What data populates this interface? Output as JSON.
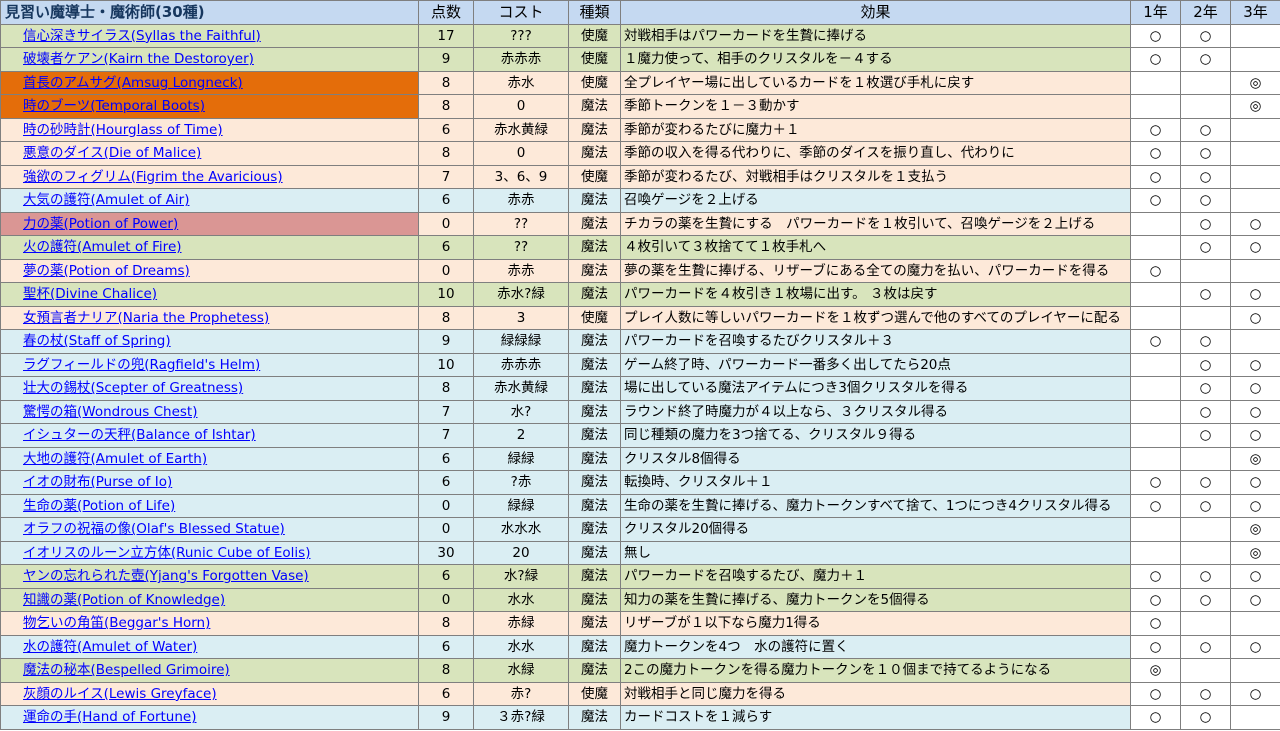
{
  "header": {
    "title": "見習い魔導士・魔術師(30種)",
    "points": "点数",
    "cost": "コスト",
    "kind": "種類",
    "effect": "効果",
    "y1": "1年",
    "y2": "2年",
    "y3": "3年"
  },
  "colors": {
    "green": "#d8e4bc",
    "blue": "#daeef3",
    "peach": "#fde9d9",
    "orange": "#e46d0a",
    "rose": "#da9694",
    "header": "#c5d9f1",
    "link": "#0000ff"
  },
  "rows": [
    {
      "name": "信心深きサイラス(Syllas the Faithful)",
      "bg": "green",
      "points": "17",
      "cost": "???",
      "kind": "使魔",
      "effect": "対戦相手はパワーカードを生贄に捧げる",
      "y1": "○",
      "y2": "○",
      "y3": ""
    },
    {
      "name": "破壊者ケアン(Kairn the Destoroyer)",
      "bg": "green",
      "points": "9",
      "cost": "赤赤赤",
      "kind": "使魔",
      "effect": "１魔力使って、相手のクリスタルを－４する",
      "y1": "○",
      "y2": "○",
      "y3": ""
    },
    {
      "name": "首長のアムサグ(Amsug Longneck)",
      "bg": "orange",
      "points": "8",
      "cost": "赤水",
      "kind": "使魔",
      "effect": "全プレイヤー場に出しているカードを１枚選び手札に戻す",
      "y1": "",
      "y2": "",
      "y3": "◎"
    },
    {
      "name": "時のブーツ(Temporal Boots)",
      "bg": "orange",
      "points": "8",
      "cost": "0",
      "kind": "魔法",
      "effect": "季節トークンを１－３動かす",
      "y1": "",
      "y2": "",
      "y3": "◎"
    },
    {
      "name": "時の砂時計(Hourglass of Time)",
      "bg": "peach",
      "points": "6",
      "cost": "赤水黄緑",
      "kind": "魔法",
      "effect": "季節が変わるたびに魔力＋１",
      "y1": "○",
      "y2": "○",
      "y3": ""
    },
    {
      "name": "悪意のダイス(Die of Malice)",
      "bg": "peach",
      "points": "8",
      "cost": "0",
      "kind": "魔法",
      "effect": "季節の収入を得る代わりに、季節のダイスを振り直し、代わりに",
      "y1": "○",
      "y2": "○",
      "y3": ""
    },
    {
      "name": "強欲のフィグリム(Figrim the Avaricious)",
      "bg": "peach",
      "points": "7",
      "cost": "3、6、9",
      "kind": "使魔",
      "effect": "季節が変わるたび、対戦相手はクリスタルを１支払う",
      "y1": "○",
      "y2": "○",
      "y3": ""
    },
    {
      "name": "大気の護符(Amulet of Air)",
      "bg": "blue",
      "points": "6",
      "cost": "赤赤",
      "kind": "魔法",
      "effect": "召喚ゲージを２上げる",
      "y1": "○",
      "y2": "○",
      "y3": ""
    },
    {
      "name": "力の薬(Potion of Power)",
      "bg": "rose",
      "points": "0",
      "cost": "??",
      "kind": "魔法",
      "effect": "チカラの薬を生贄にする　パワーカードを１枚引いて、召喚ゲージを２上げる",
      "y1": "",
      "y2": "○",
      "y3": "○"
    },
    {
      "name": "火の護符(Amulet of Fire)",
      "bg": "green",
      "points": "6",
      "cost": "??",
      "kind": "魔法",
      "effect": "４枚引いて３枚捨てて１枚手札へ",
      "y1": "",
      "y2": "○",
      "y3": "○"
    },
    {
      "name": "夢の薬(Potion of Dreams)",
      "bg": "peach",
      "points": "0",
      "cost": "赤赤",
      "kind": "魔法",
      "effect": "夢の薬を生贄に捧げる、リザーブにある全ての魔力を払い、パワーカードを得る",
      "y1": "○",
      "y2": "",
      "y3": ""
    },
    {
      "name": "聖杯(Divine Chalice)",
      "bg": "green",
      "points": "10",
      "cost": "赤水?緑",
      "kind": "魔法",
      "effect": "パワーカードを４枚引き１枚場に出す。 ３枚は戻す",
      "y1": "",
      "y2": "○",
      "y3": "○"
    },
    {
      "name": "女預言者ナリア(Naria the Prophetess)",
      "bg": "peach",
      "points": "8",
      "cost": "3",
      "kind": "使魔",
      "effect": "プレイ人数に等しいパワーカードを１枚ずつ選んで他のすべてのプレイヤーに配る",
      "y1": "",
      "y2": "",
      "y3": "○"
    },
    {
      "name": "春の杖(Staff of Spring)",
      "bg": "blue",
      "points": "9",
      "cost": "緑緑緑",
      "kind": "魔法",
      "effect": "パワーカードを召喚するたびクリスタル＋３",
      "y1": "○",
      "y2": "○",
      "y3": ""
    },
    {
      "name": "ラグフィールドの兜(Ragfield's Helm)",
      "bg": "blue",
      "points": "10",
      "cost": "赤赤赤",
      "kind": "魔法",
      "effect": "ゲーム終了時、パワーカード一番多く出してたら20点",
      "y1": "",
      "y2": "○",
      "y3": "○"
    },
    {
      "name": "壮大の錫杖(Scepter of Greatness)",
      "bg": "blue",
      "points": "8",
      "cost": "赤水黄緑",
      "kind": "魔法",
      "effect": "場に出している魔法アイテムにつき3個クリスタルを得る",
      "y1": "",
      "y2": "○",
      "y3": "○"
    },
    {
      "name": "驚愕の箱(Wondrous Chest)",
      "bg": "blue",
      "points": "7",
      "cost": "水?",
      "kind": "魔法",
      "effect": "ラウンド終了時魔力が４以上なら、３クリスタル得る",
      "y1": "",
      "y2": "○",
      "y3": "○"
    },
    {
      "name": "イシュターの天秤(Balance of Ishtar)",
      "bg": "blue",
      "points": "7",
      "cost": "2",
      "kind": "魔法",
      "effect": "同じ種類の魔力を3つ捨てる、クリスタル９得る",
      "y1": "",
      "y2": "○",
      "y3": "○"
    },
    {
      "name": "大地の護符(Amulet of Earth)",
      "bg": "blue",
      "points": "6",
      "cost": "緑緑",
      "kind": "魔法",
      "effect": "クリスタル8個得る",
      "y1": "",
      "y2": "",
      "y3": "◎"
    },
    {
      "name": "イオの財布(Purse of Io)",
      "bg": "blue",
      "points": "6",
      "cost": "?赤",
      "kind": "魔法",
      "effect": "転換時、クリスタル＋１",
      "y1": "○",
      "y2": "○",
      "y3": "○"
    },
    {
      "name": "生命の薬(Potion of Life)",
      "bg": "blue",
      "points": "0",
      "cost": "緑緑",
      "kind": "魔法",
      "effect": "生命の薬を生贄に捧げる、魔力トークンすべて捨て、1つにつき4クリスタル得る",
      "y1": "○",
      "y2": "○",
      "y3": "○"
    },
    {
      "name": "オラフの祝福の像(Olaf's Blessed Statue)",
      "bg": "blue",
      "points": "0",
      "cost": "水水水",
      "kind": "魔法",
      "effect": "クリスタル20個得る",
      "y1": "",
      "y2": "",
      "y3": "◎"
    },
    {
      "name": "イオリスのルーン立方体(Runic Cube of Eolis)",
      "bg": "blue",
      "points": "30",
      "cost": "20",
      "kind": "魔法",
      "effect": "無し",
      "y1": "",
      "y2": "",
      "y3": "◎"
    },
    {
      "name": "ヤンの忘れられた壺(Yjang's Forgotten Vase)",
      "bg": "green",
      "points": "6",
      "cost": "水?緑",
      "kind": "魔法",
      "effect": "パワーカードを召喚するたび、魔力＋１",
      "y1": "○",
      "y2": "○",
      "y3": "○"
    },
    {
      "name": "知識の薬(Potion of Knowledge)",
      "bg": "green",
      "points": "0",
      "cost": "水水",
      "kind": "魔法",
      "effect": "知力の薬を生贄に捧げる、魔力トークンを5個得る",
      "y1": "○",
      "y2": "○",
      "y3": "○"
    },
    {
      "name": "物乞いの角笛(Beggar's Horn)",
      "bg": "peach",
      "points": "8",
      "cost": "赤緑",
      "kind": "魔法",
      "effect": "リザーブが１以下なら魔力1得る",
      "y1": "○",
      "y2": "",
      "y3": ""
    },
    {
      "name": "水の護符(Amulet of Water)",
      "bg": "blue",
      "points": "6",
      "cost": "水水",
      "kind": "魔法",
      "effect": "魔力トークンを4つ　水の護符に置く",
      "y1": "○",
      "y2": "○",
      "y3": "○"
    },
    {
      "name": "魔法の秘本(Bespelled Grimoire)",
      "bg": "green",
      "points": "8",
      "cost": "水緑",
      "kind": "魔法",
      "effect": "2この魔力トークンを得る魔力トークンを１０個まで持てるようになる",
      "y1": "◎",
      "y2": "",
      "y3": ""
    },
    {
      "name": "灰顔のルイス(Lewis Greyface)",
      "bg": "peach",
      "points": "6",
      "cost": "赤?",
      "kind": "使魔",
      "effect": "対戦相手と同じ魔力を得る",
      "y1": "○",
      "y2": "○",
      "y3": "○"
    },
    {
      "name": "運命の手(Hand of Fortune)",
      "bg": "blue",
      "points": "9",
      "cost": "３赤?緑",
      "kind": "魔法",
      "effect": "カードコストを１減らす",
      "y1": "○",
      "y2": "○",
      "y3": ""
    }
  ]
}
